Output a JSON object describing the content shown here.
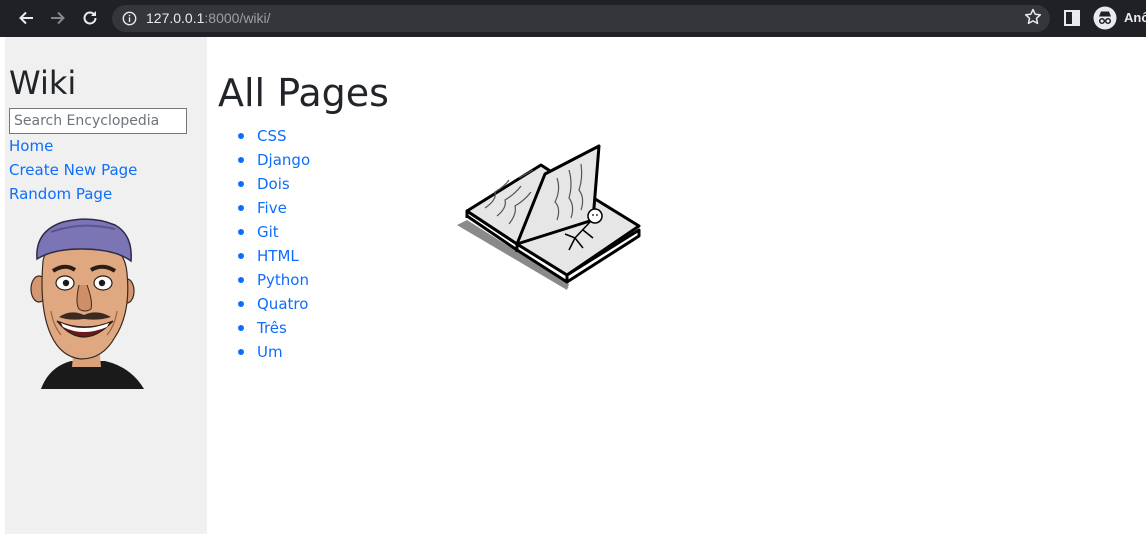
{
  "browser": {
    "url_host": "127.0.0.1",
    "url_path": ":8000/wiki/",
    "profile_label": "Anô",
    "icons": [
      "back-arrow-icon",
      "forward-arrow-icon",
      "reload-icon",
      "info-icon",
      "bookmark-star-icon",
      "side-panel-icon",
      "incognito-icon"
    ]
  },
  "sidebar": {
    "title": "Wiki",
    "search_placeholder": "Search Encyclopedia",
    "links": {
      "home": "Home",
      "create": "Create New Page",
      "random": "Random Page"
    }
  },
  "main": {
    "title": "All Pages",
    "entries": [
      "CSS",
      "Django",
      "Dois",
      "Five",
      "Git",
      "HTML",
      "Python",
      "Quatro",
      "Três",
      "Um"
    ]
  },
  "colors": {
    "link": "#0d6efd",
    "sidebar_bg": "#f0f0f0",
    "chrome_bg": "#202124"
  }
}
